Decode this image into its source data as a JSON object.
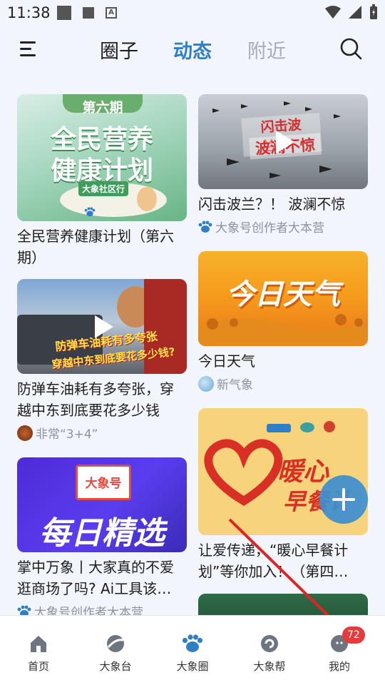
{
  "status_bar": {
    "time": "11:38",
    "a_glyph": "A"
  },
  "header": {
    "tabs": [
      {
        "label": "圈子"
      },
      {
        "label": "动态"
      },
      {
        "label": "附近"
      }
    ],
    "active_tab": "动态"
  },
  "feed": {
    "left": [
      {
        "title": "全民营养健康计划（第六期）",
        "overlay": {
          "badge": "第六期",
          "headline_1": "全民营养",
          "headline_2": "健康计划",
          "tag": "大象社区行"
        }
      },
      {
        "title": "防弹车油耗有多夸张，穿越中东到底要花多少钱",
        "overlay": {
          "line1": "防弹车油耗有多夸张",
          "line2": "穿越中东到底要花多少钱?"
        },
        "author": "非常“3+4”"
      },
      {
        "title": "掌中万象丨大家真的不爱逛商场了吗? Ai工具该…",
        "overlay": {
          "tag": "大象号",
          "headline": "每日精选"
        },
        "author": "大象号创作者大本营"
      }
    ],
    "right": [
      {
        "title": "闪击波兰？！ 波澜不惊",
        "overlay": {
          "line1": "闪击波兰？！",
          "line2": "波澜不惊"
        },
        "author": "大象号创作者大本营"
      },
      {
        "title": "今日天气",
        "overlay": {
          "headline": "今日天气"
        },
        "author": "新气象"
      },
      {
        "title": "让爱传递，“暖心早餐计划”等你加入！（第四…",
        "overlay": {
          "headline_1": "暖心",
          "headline_2": "早餐计"
        }
      }
    ]
  },
  "bottom_nav": {
    "items": [
      {
        "label": "首页"
      },
      {
        "label": "大象台"
      },
      {
        "label": "大象圈"
      },
      {
        "label": "大象帮"
      },
      {
        "label": "我的"
      }
    ],
    "badge": "72"
  },
  "colors": {
    "accent": "#2f7fc6",
    "badge": "#e53b3b",
    "arrow": "#e02424"
  }
}
